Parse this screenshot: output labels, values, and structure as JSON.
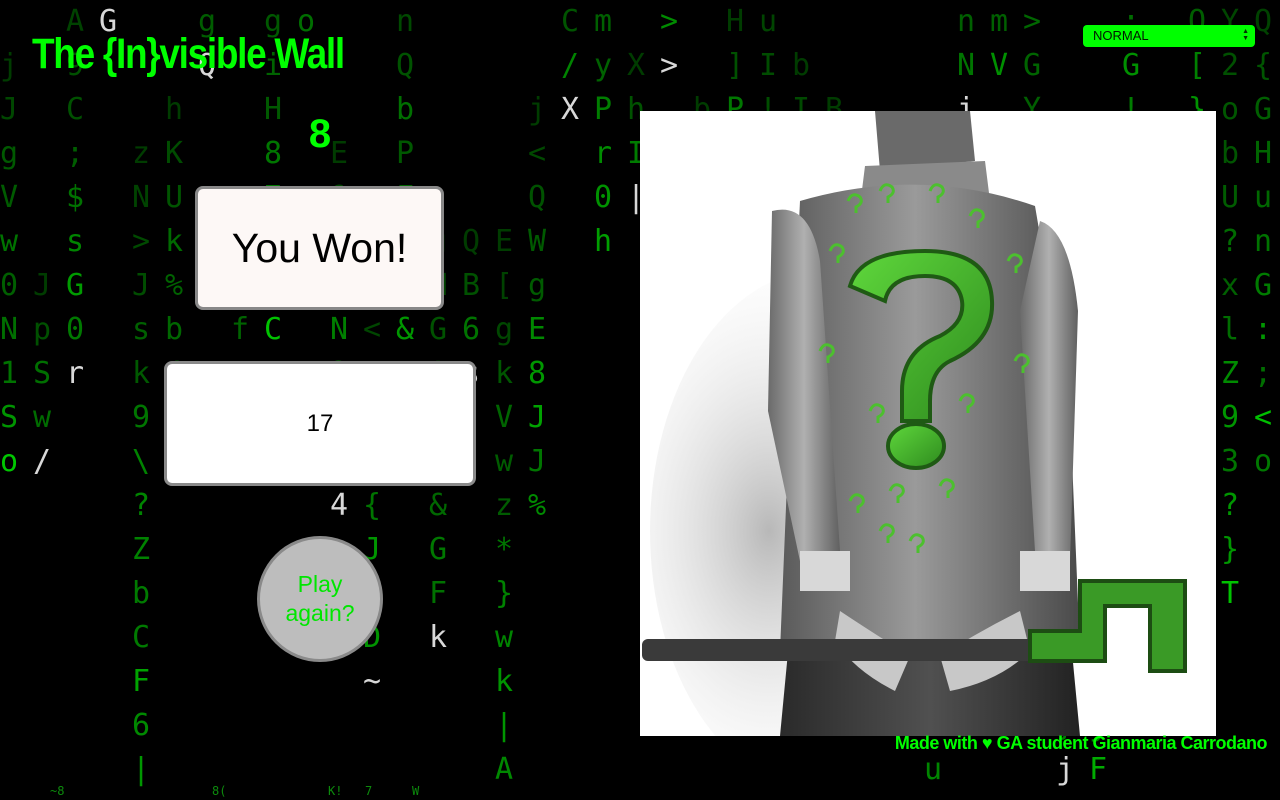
{
  "header": {
    "title": "The {In}visible Wall"
  },
  "mode_select": {
    "value": "NORMAL"
  },
  "game": {
    "counter": "8",
    "result": "You Won!",
    "guess_value": "17",
    "play_again_label": "Play again?"
  },
  "footer": {
    "credit": "Made with ♥ GA student Gianmaria Carrodano"
  },
  "colors": {
    "accent": "#00ff00",
    "background": "#000000",
    "panel": "#fdf8f6",
    "button_bg": "#bdbdbd"
  },
  "images": {
    "main": "riddler-question-mark-suit-with-cane"
  }
}
